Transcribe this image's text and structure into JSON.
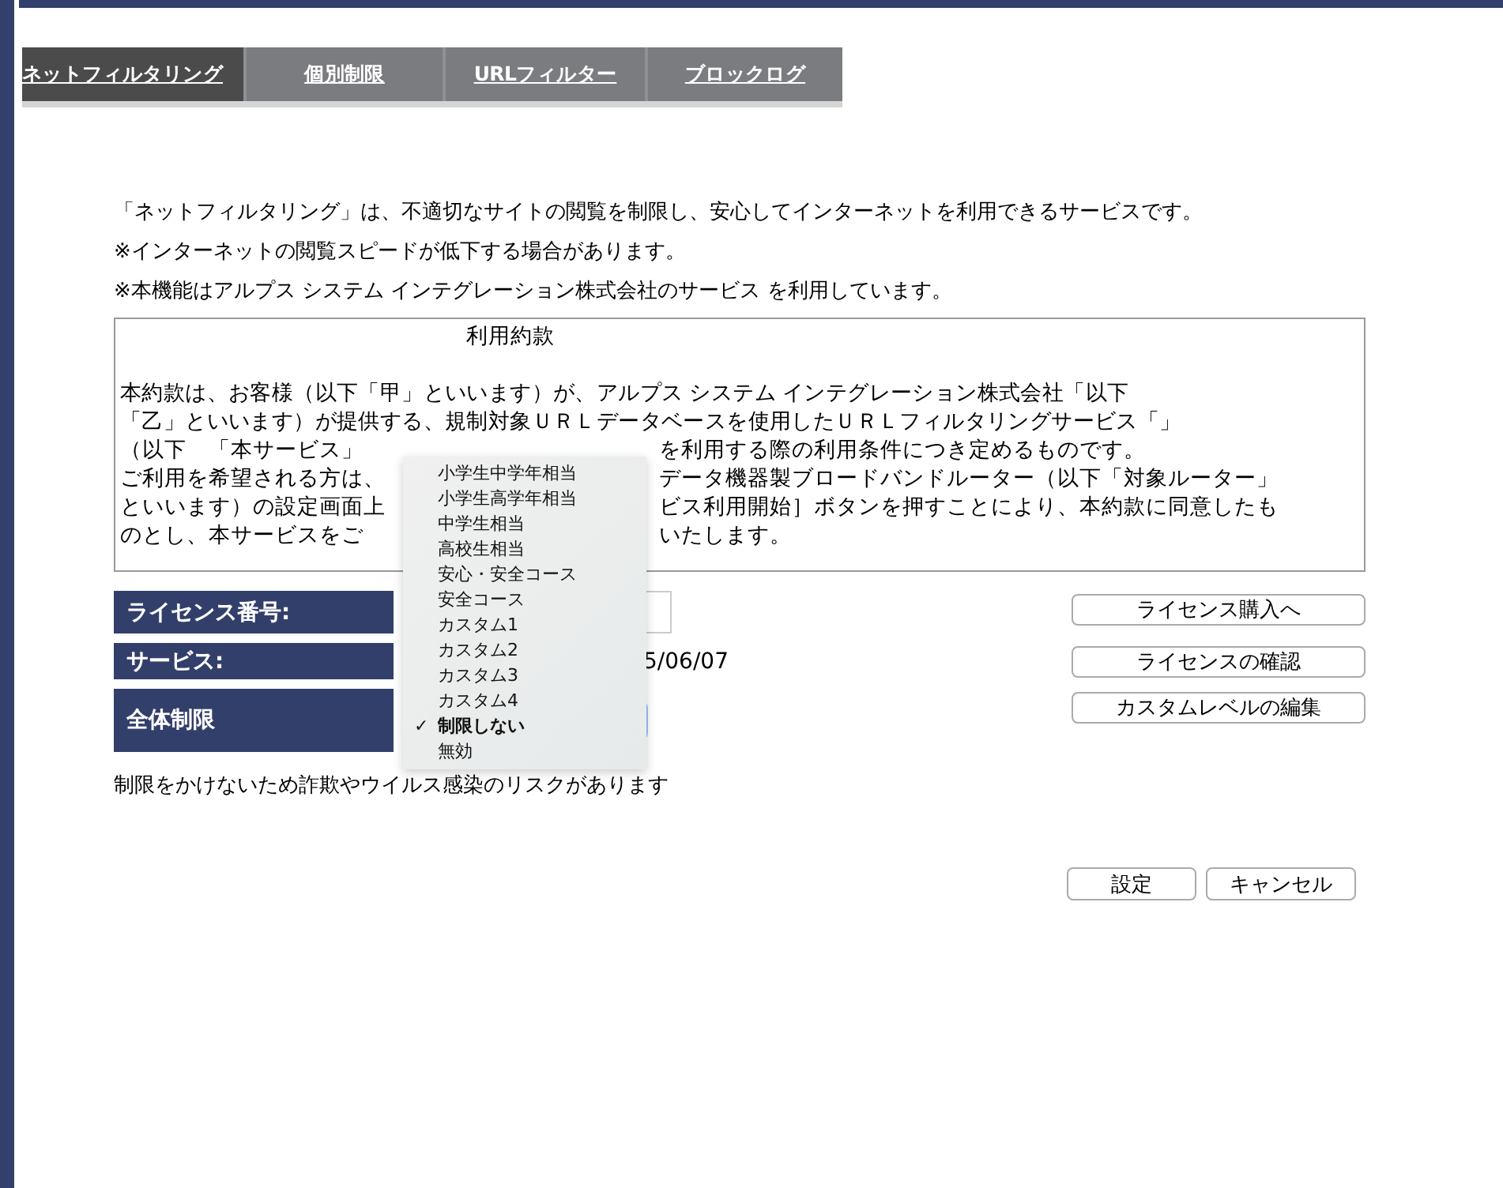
{
  "tabs": [
    {
      "label": "ネットフィルタリング",
      "selected": true
    },
    {
      "label": "個別制限",
      "selected": false
    },
    {
      "label": "URLフィルター",
      "selected": false
    },
    {
      "label": "ブロックログ",
      "selected": false
    }
  ],
  "intro": [
    "「ネットフィルタリング」は、不適切なサイトの閲覧を制限し、安心してインターネットを利用できるサービスです。",
    "※インターネットの閲覧スピードが低下する場合があります。",
    "※本機能はアルプス システム インテグレーション株式会社のサービス を利用しています。"
  ],
  "terms": {
    "title": "利用約款",
    "lines": [
      {
        "left": "本約款は、お客様（以下「甲」といいます）が、アルプス システム インテグレーション株式会社「以下"
      },
      {
        "left": "「乙」といいます）が提供する、規制対象ＵＲＬデータベースを使用したＵＲＬフィルタリングサービス「」"
      },
      {
        "left": "（以下　「本サービス」",
        "right": "を利用する際の利用条件につき定めるものです。"
      },
      {
        "left": "ご利用を希望される方は、",
        "right": "データ機器製ブロードバンドルーター（以下「対象ルーター」"
      },
      {
        "left": "といいます）の設定画面上",
        "right": "ビス利用開始］ボタンを押すことにより、本約款に同意したも"
      },
      {
        "left": "のとし、本サービスをご",
        "right": "いたします。"
      }
    ]
  },
  "form": {
    "license_label": "ライセンス番号:",
    "service_label": "サービス:",
    "service_value": "5/06/07",
    "restriction_label": "全体制限"
  },
  "side_buttons": [
    "ライセンス購入へ",
    "ライセンスの確認",
    "カスタムレベルの編集"
  ],
  "dropdown": [
    {
      "label": "小学生中学年相当",
      "selected": false
    },
    {
      "label": "小学生高学年相当",
      "selected": false
    },
    {
      "label": "中学生相当",
      "selected": false
    },
    {
      "label": "高校生相当",
      "selected": false
    },
    {
      "label": "安心・安全コース",
      "selected": false
    },
    {
      "label": "安全コース",
      "selected": false
    },
    {
      "label": "カスタム1",
      "selected": false
    },
    {
      "label": "カスタム2",
      "selected": false
    },
    {
      "label": "カスタム3",
      "selected": false
    },
    {
      "label": "カスタム4",
      "selected": false
    },
    {
      "label": "制限しない",
      "selected": true,
      "check": "✓"
    },
    {
      "label": "無効",
      "selected": false
    }
  ],
  "note": "制限をかけないため詐欺やウイルス感染のリスクがあります",
  "buttons": [
    "設定",
    "キャンセル"
  ]
}
